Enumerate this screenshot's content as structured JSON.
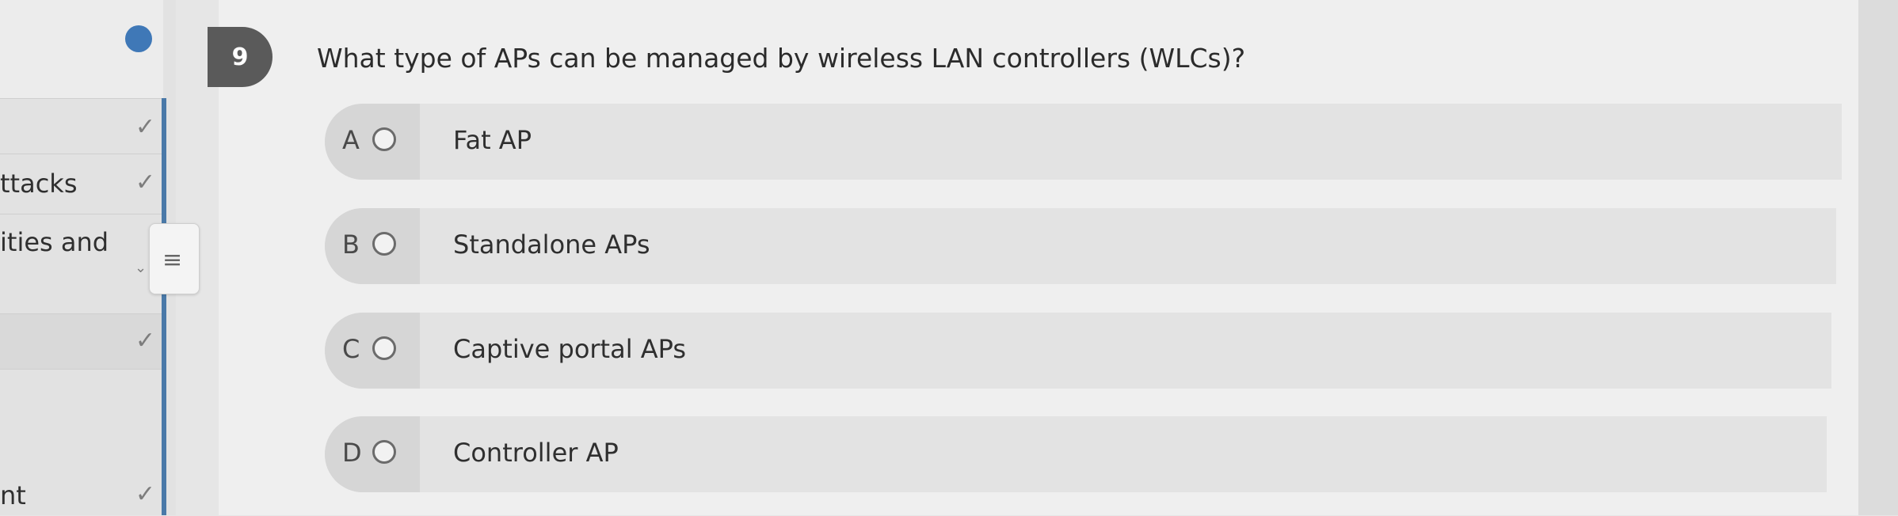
{
  "sidebar": {
    "items": [
      {
        "label": "",
        "checked": true
      },
      {
        "label": "ttacks",
        "checked": true
      },
      {
        "label": "ities and",
        "checked": false
      },
      {
        "label": "",
        "checked": true
      },
      {
        "label": "nt",
        "checked": true
      }
    ],
    "check_glyph": "✓",
    "menu_glyph": "≡",
    "caret_glyph": "⌄"
  },
  "question": {
    "number": "9",
    "text": "What type of APs can be managed by wireless LAN controllers (WLCs)?"
  },
  "options": [
    {
      "letter": "A",
      "text": "Fat AP"
    },
    {
      "letter": "B",
      "text": "Standalone APs"
    },
    {
      "letter": "C",
      "text": "Captive portal APs"
    },
    {
      "letter": "D",
      "text": "Controller AP"
    }
  ],
  "colors": {
    "accent": "#4a79a8",
    "question_badge": "#5a5a5a",
    "progress": "#3f78b7"
  }
}
